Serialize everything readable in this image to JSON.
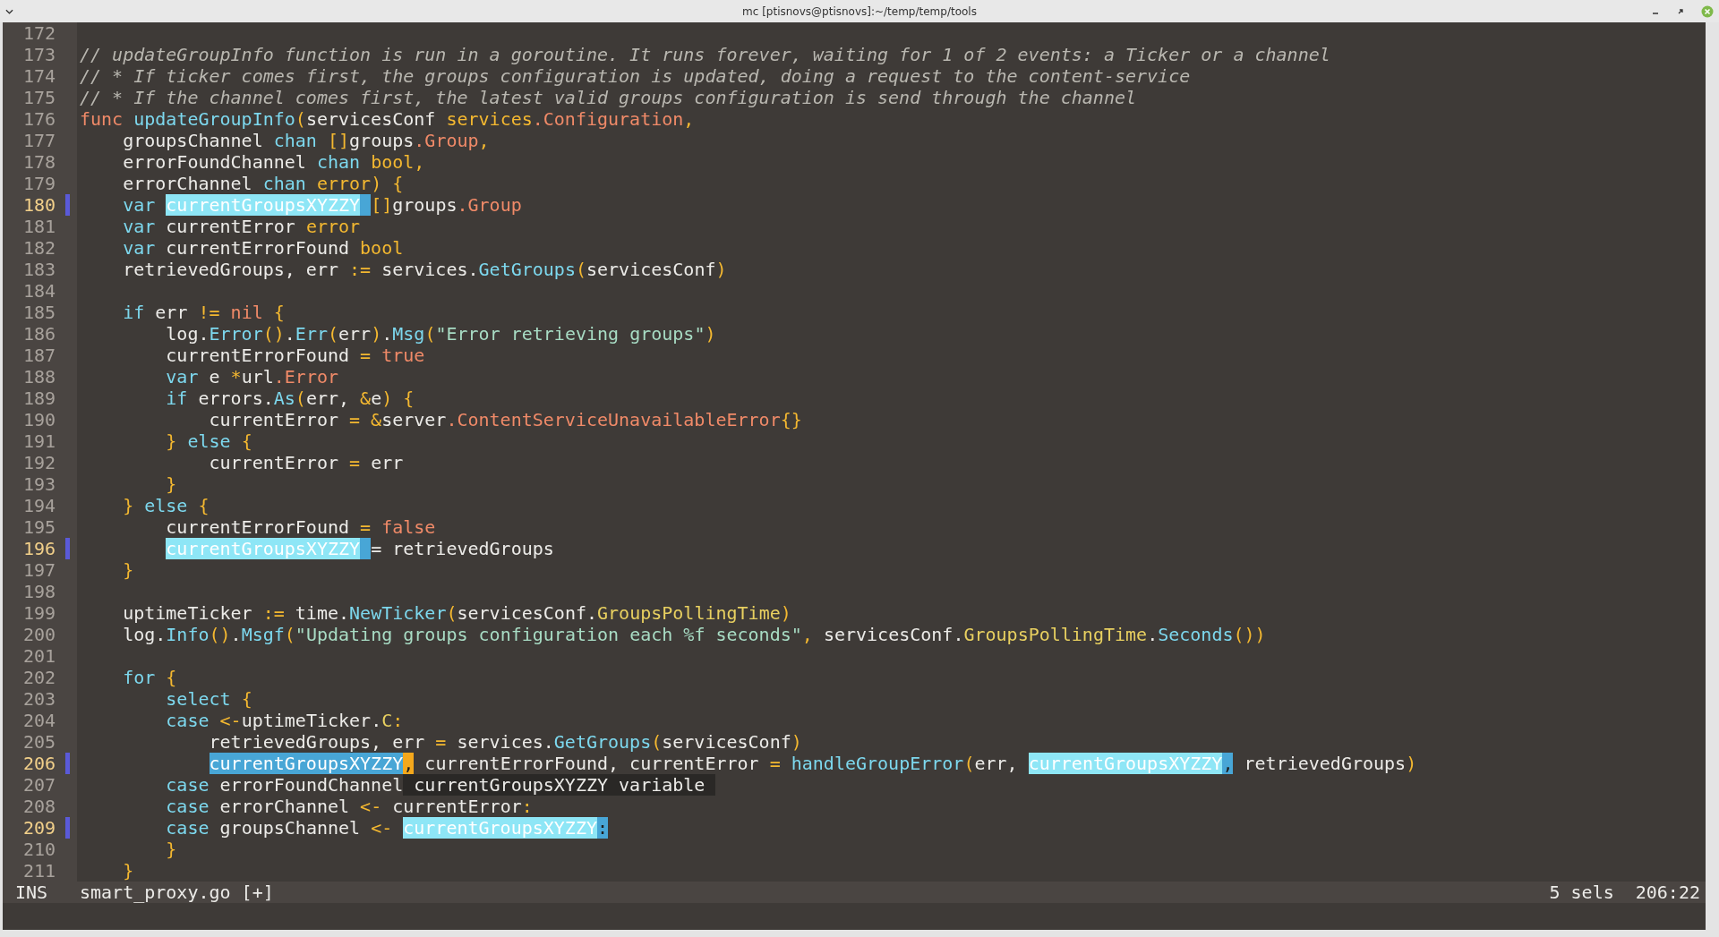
{
  "window": {
    "title": "mc [ptisnovs@ptisnovs]:~/temp/temp/tools"
  },
  "editor": {
    "lines": [
      {
        "number": "172",
        "marked": false
      },
      {
        "number": "173",
        "marked": false,
        "tokens": [
          {
            "text": "// updateGroupInfo function is run in a goroutine. It runs forever, waiting for 1 of 2 events: a Ticker or a channel",
            "kind": "comment"
          }
        ]
      },
      {
        "number": "174",
        "marked": false,
        "tokens": [
          {
            "text": "// * If ticker comes first, the groups configuration is updated, doing a request to the content-service",
            "kind": "comment"
          }
        ]
      },
      {
        "number": "175",
        "marked": false,
        "tokens": [
          {
            "text": "// * If the channel comes first, the latest valid groups configuration is send through the channel",
            "kind": "comment"
          }
        ]
      },
      {
        "number": "176",
        "marked": false,
        "tokens": [
          {
            "text": "func",
            "kind": "value"
          },
          {
            "text": " updateGroupInfo",
            "kind": "function"
          },
          {
            "text": "(",
            "kind": "punct"
          },
          {
            "text": "servicesConf ",
            "kind": "text"
          },
          {
            "text": "services",
            "kind": "punct"
          },
          {
            "text": ".Configuration",
            "kind": "value"
          },
          {
            "text": ",",
            "kind": "punct"
          }
        ]
      },
      {
        "number": "177",
        "marked": false,
        "tokens": [
          {
            "text": "    groupsChannel ",
            "kind": "text"
          },
          {
            "text": "chan ",
            "kind": "keyword"
          },
          {
            "text": "[]",
            "kind": "punct"
          },
          {
            "text": "groups",
            "kind": "text"
          },
          {
            "text": ".Group",
            "kind": "value"
          },
          {
            "text": ",",
            "kind": "punct"
          }
        ]
      },
      {
        "number": "178",
        "marked": false,
        "tokens": [
          {
            "text": "    errorFoundChannel ",
            "kind": "text"
          },
          {
            "text": "chan ",
            "kind": "keyword"
          },
          {
            "text": "bool,",
            "kind": "punct"
          }
        ]
      },
      {
        "number": "179",
        "marked": false,
        "tokens": [
          {
            "text": "    errorChannel ",
            "kind": "text"
          },
          {
            "text": "chan ",
            "kind": "keyword"
          },
          {
            "text": "error) {",
            "kind": "punct"
          }
        ]
      },
      {
        "number": "180",
        "marked": true,
        "tokens": [
          {
            "text": "    var ",
            "kind": "keyword"
          },
          {
            "text": "currentGroupsXYZZY ",
            "kind": "selection"
          },
          {
            "text": "[]",
            "kind": "punct"
          },
          {
            "text": "groups",
            "kind": "text"
          },
          {
            "text": ".Group",
            "kind": "value"
          }
        ]
      },
      {
        "number": "181",
        "marked": false,
        "tokens": [
          {
            "text": "    var ",
            "kind": "keyword"
          },
          {
            "text": "currentError ",
            "kind": "text"
          },
          {
            "text": "error",
            "kind": "punct"
          }
        ]
      },
      {
        "number": "182",
        "marked": false,
        "tokens": [
          {
            "text": "    var ",
            "kind": "keyword"
          },
          {
            "text": "currentErrorFound ",
            "kind": "text"
          },
          {
            "text": "bool",
            "kind": "punct"
          }
        ]
      },
      {
        "number": "183",
        "marked": false,
        "tokens": [
          {
            "text": "    retrievedGroups, err ",
            "kind": "text"
          },
          {
            "text": ":=",
            "kind": "punct"
          },
          {
            "text": " services.",
            "kind": "text"
          },
          {
            "text": "GetGroups",
            "kind": "function"
          },
          {
            "text": "(",
            "kind": "punct"
          },
          {
            "text": "servicesConf",
            "kind": "text"
          },
          {
            "text": ")",
            "kind": "punct"
          }
        ]
      },
      {
        "number": "184",
        "marked": false
      },
      {
        "number": "185",
        "marked": false,
        "tokens": [
          {
            "text": "    if ",
            "kind": "keyword"
          },
          {
            "text": "err ",
            "kind": "text"
          },
          {
            "text": "!= ",
            "kind": "punct"
          },
          {
            "text": "nil ",
            "kind": "value"
          },
          {
            "text": "{",
            "kind": "punct"
          }
        ]
      },
      {
        "number": "186",
        "marked": false,
        "tokens": [
          {
            "text": "        log.",
            "kind": "text"
          },
          {
            "text": "Error",
            "kind": "function"
          },
          {
            "text": "()",
            "kind": "punct"
          },
          {
            "text": ".",
            "kind": "text"
          },
          {
            "text": "Err",
            "kind": "function"
          },
          {
            "text": "(",
            "kind": "punct"
          },
          {
            "text": "err",
            "kind": "text"
          },
          {
            "text": ")",
            "kind": "punct"
          },
          {
            "text": ".",
            "kind": "text"
          },
          {
            "text": "Msg",
            "kind": "function"
          },
          {
            "text": "(",
            "kind": "punct"
          },
          {
            "text": "\"Error retrieving groups\"",
            "kind": "string"
          },
          {
            "text": ")",
            "kind": "punct"
          }
        ]
      },
      {
        "number": "187",
        "marked": false,
        "tokens": [
          {
            "text": "        currentErrorFound ",
            "kind": "text"
          },
          {
            "text": "= ",
            "kind": "punct"
          },
          {
            "text": "true",
            "kind": "value"
          }
        ]
      },
      {
        "number": "188",
        "marked": false,
        "tokens": [
          {
            "text": "        var ",
            "kind": "keyword"
          },
          {
            "text": "e ",
            "kind": "text"
          },
          {
            "text": "*",
            "kind": "punct"
          },
          {
            "text": "url",
            "kind": "text"
          },
          {
            "text": ".Error",
            "kind": "value"
          }
        ]
      },
      {
        "number": "189",
        "marked": false,
        "tokens": [
          {
            "text": "        if ",
            "kind": "keyword"
          },
          {
            "text": "errors.",
            "kind": "text"
          },
          {
            "text": "As",
            "kind": "function"
          },
          {
            "text": "(",
            "kind": "punct"
          },
          {
            "text": "err, ",
            "kind": "text"
          },
          {
            "text": "&",
            "kind": "punct"
          },
          {
            "text": "e",
            "kind": "text"
          },
          {
            "text": ") {",
            "kind": "punct"
          }
        ]
      },
      {
        "number": "190",
        "marked": false,
        "tokens": [
          {
            "text": "            currentError ",
            "kind": "text"
          },
          {
            "text": "= &",
            "kind": "punct"
          },
          {
            "text": "server",
            "kind": "text"
          },
          {
            "text": ".ContentServiceUnavailableError",
            "kind": "value"
          },
          {
            "text": "{}",
            "kind": "punct"
          }
        ]
      },
      {
        "number": "191",
        "marked": false,
        "tokens": [
          {
            "text": "        } ",
            "kind": "punct"
          },
          {
            "text": "else ",
            "kind": "keyword"
          },
          {
            "text": "{",
            "kind": "punct"
          }
        ]
      },
      {
        "number": "192",
        "marked": false,
        "tokens": [
          {
            "text": "            currentError ",
            "kind": "text"
          },
          {
            "text": "= ",
            "kind": "punct"
          },
          {
            "text": "err",
            "kind": "text"
          }
        ]
      },
      {
        "number": "193",
        "marked": false,
        "tokens": [
          {
            "text": "        }",
            "kind": "punct"
          }
        ]
      },
      {
        "number": "194",
        "marked": false,
        "tokens": [
          {
            "text": "    } ",
            "kind": "punct"
          },
          {
            "text": "else ",
            "kind": "keyword"
          },
          {
            "text": "{",
            "kind": "punct"
          }
        ]
      },
      {
        "number": "195",
        "marked": false,
        "tokens": [
          {
            "text": "        currentErrorFound ",
            "kind": "text"
          },
          {
            "text": "= ",
            "kind": "punct"
          },
          {
            "text": "false",
            "kind": "value"
          }
        ]
      },
      {
        "number": "196",
        "marked": true,
        "tokens": [
          {
            "text": "        currentGroupsXYZZY ",
            "kind": "selection"
          },
          {
            "text": "= retrievedGroups",
            "kind": "text"
          }
        ]
      },
      {
        "number": "197",
        "marked": false,
        "tokens": [
          {
            "text": "    }",
            "kind": "punct"
          }
        ]
      },
      {
        "number": "198",
        "marked": false
      },
      {
        "number": "199",
        "marked": false,
        "tokens": [
          {
            "text": "    uptimeTicker ",
            "kind": "text"
          },
          {
            "text": ":= ",
            "kind": "punct"
          },
          {
            "text": "time.",
            "kind": "text"
          },
          {
            "text": "NewTicker",
            "kind": "function"
          },
          {
            "text": "(",
            "kind": "punct"
          },
          {
            "text": "servicesConf.",
            "kind": "text"
          },
          {
            "text": "GroupsPollingTime",
            "kind": "field"
          },
          {
            "text": ")",
            "kind": "punct"
          }
        ]
      },
      {
        "number": "200",
        "marked": false,
        "tokens": [
          {
            "text": "    log.",
            "kind": "text"
          },
          {
            "text": "Info",
            "kind": "function"
          },
          {
            "text": "()",
            "kind": "punct"
          },
          {
            "text": ".",
            "kind": "text"
          },
          {
            "text": "Msgf",
            "kind": "function"
          },
          {
            "text": "(",
            "kind": "punct"
          },
          {
            "text": "\"Updating groups configuration each %f seconds\"",
            "kind": "string"
          },
          {
            "text": ",",
            "kind": "punct"
          },
          {
            "text": " servicesConf.",
            "kind": "text"
          },
          {
            "text": "GroupsPollingTime",
            "kind": "field"
          },
          {
            "text": ".",
            "kind": "text"
          },
          {
            "text": "Seconds",
            "kind": "function"
          },
          {
            "text": "())",
            "kind": "punct"
          }
        ]
      },
      {
        "number": "201",
        "marked": false
      },
      {
        "number": "202",
        "marked": false,
        "tokens": [
          {
            "text": "    for ",
            "kind": "keyword"
          },
          {
            "text": "{",
            "kind": "punct"
          }
        ]
      },
      {
        "number": "203",
        "marked": false,
        "tokens": [
          {
            "text": "        select ",
            "kind": "keyword"
          },
          {
            "text": "{",
            "kind": "punct"
          }
        ]
      },
      {
        "number": "204",
        "marked": false,
        "tokens": [
          {
            "text": "        case ",
            "kind": "keyword"
          },
          {
            "text": "<-",
            "kind": "punct"
          },
          {
            "text": "uptimeTicker.",
            "kind": "text"
          },
          {
            "text": "C",
            "kind": "field"
          },
          {
            "text": ":",
            "kind": "punct"
          }
        ]
      },
      {
        "number": "205",
        "marked": false,
        "tokens": [
          {
            "text": "            retrievedGroups, err ",
            "kind": "text"
          },
          {
            "text": "= ",
            "kind": "punct"
          },
          {
            "text": "services.",
            "kind": "text"
          },
          {
            "text": "GetGroups",
            "kind": "function"
          },
          {
            "text": "(",
            "kind": "punct"
          },
          {
            "text": "servicesConf",
            "kind": "text"
          },
          {
            "text": ")",
            "kind": "punct"
          }
        ]
      },
      {
        "number": "206",
        "marked": true,
        "tokens": [
          {
            "text": "            currentGroupsXYZZY,",
            "kind": "main-selection"
          },
          {
            "text": " currentErrorFound, currentError ",
            "kind": "text"
          },
          {
            "text": "= ",
            "kind": "punct"
          },
          {
            "text": "handleGroupError",
            "kind": "function"
          },
          {
            "text": "(",
            "kind": "punct"
          },
          {
            "text": "err, ",
            "kind": "text"
          },
          {
            "text": "currentGroupsXYZZY,",
            "kind": "selection"
          },
          {
            "text": " retrievedGroups",
            "kind": "text"
          },
          {
            "text": ")",
            "kind": "punct"
          }
        ]
      },
      {
        "number": "207",
        "marked": false,
        "tokens": [
          {
            "text": "        case ",
            "kind": "keyword"
          },
          {
            "text": "errorFoundChannel",
            "kind": "text"
          }
        ],
        "popup": " currentGroupsXYZZY variable "
      },
      {
        "number": "208",
        "marked": false,
        "tokens": [
          {
            "text": "        case ",
            "kind": "keyword"
          },
          {
            "text": "errorChannel ",
            "kind": "text"
          },
          {
            "text": "<- ",
            "kind": "punct"
          },
          {
            "text": "currentError",
            "kind": "text"
          },
          {
            "text": ":",
            "kind": "punct"
          }
        ]
      },
      {
        "number": "209",
        "marked": true,
        "tokens": [
          {
            "text": "        case ",
            "kind": "keyword"
          },
          {
            "text": "groupsChannel ",
            "kind": "text"
          },
          {
            "text": "<- ",
            "kind": "punct"
          },
          {
            "text": "currentGroupsXYZZY:",
            "kind": "selection"
          }
        ]
      },
      {
        "number": "210",
        "marked": false,
        "tokens": [
          {
            "text": "        }",
            "kind": "punct"
          }
        ]
      },
      {
        "number": "211",
        "marked": false,
        "tokens": [
          {
            "text": "    }",
            "kind": "punct"
          }
        ]
      }
    ]
  },
  "status_bar": {
    "mode": "INS",
    "file": "smart_proxy.go [+]",
    "selections": "5 sels",
    "position": "206:22"
  }
}
